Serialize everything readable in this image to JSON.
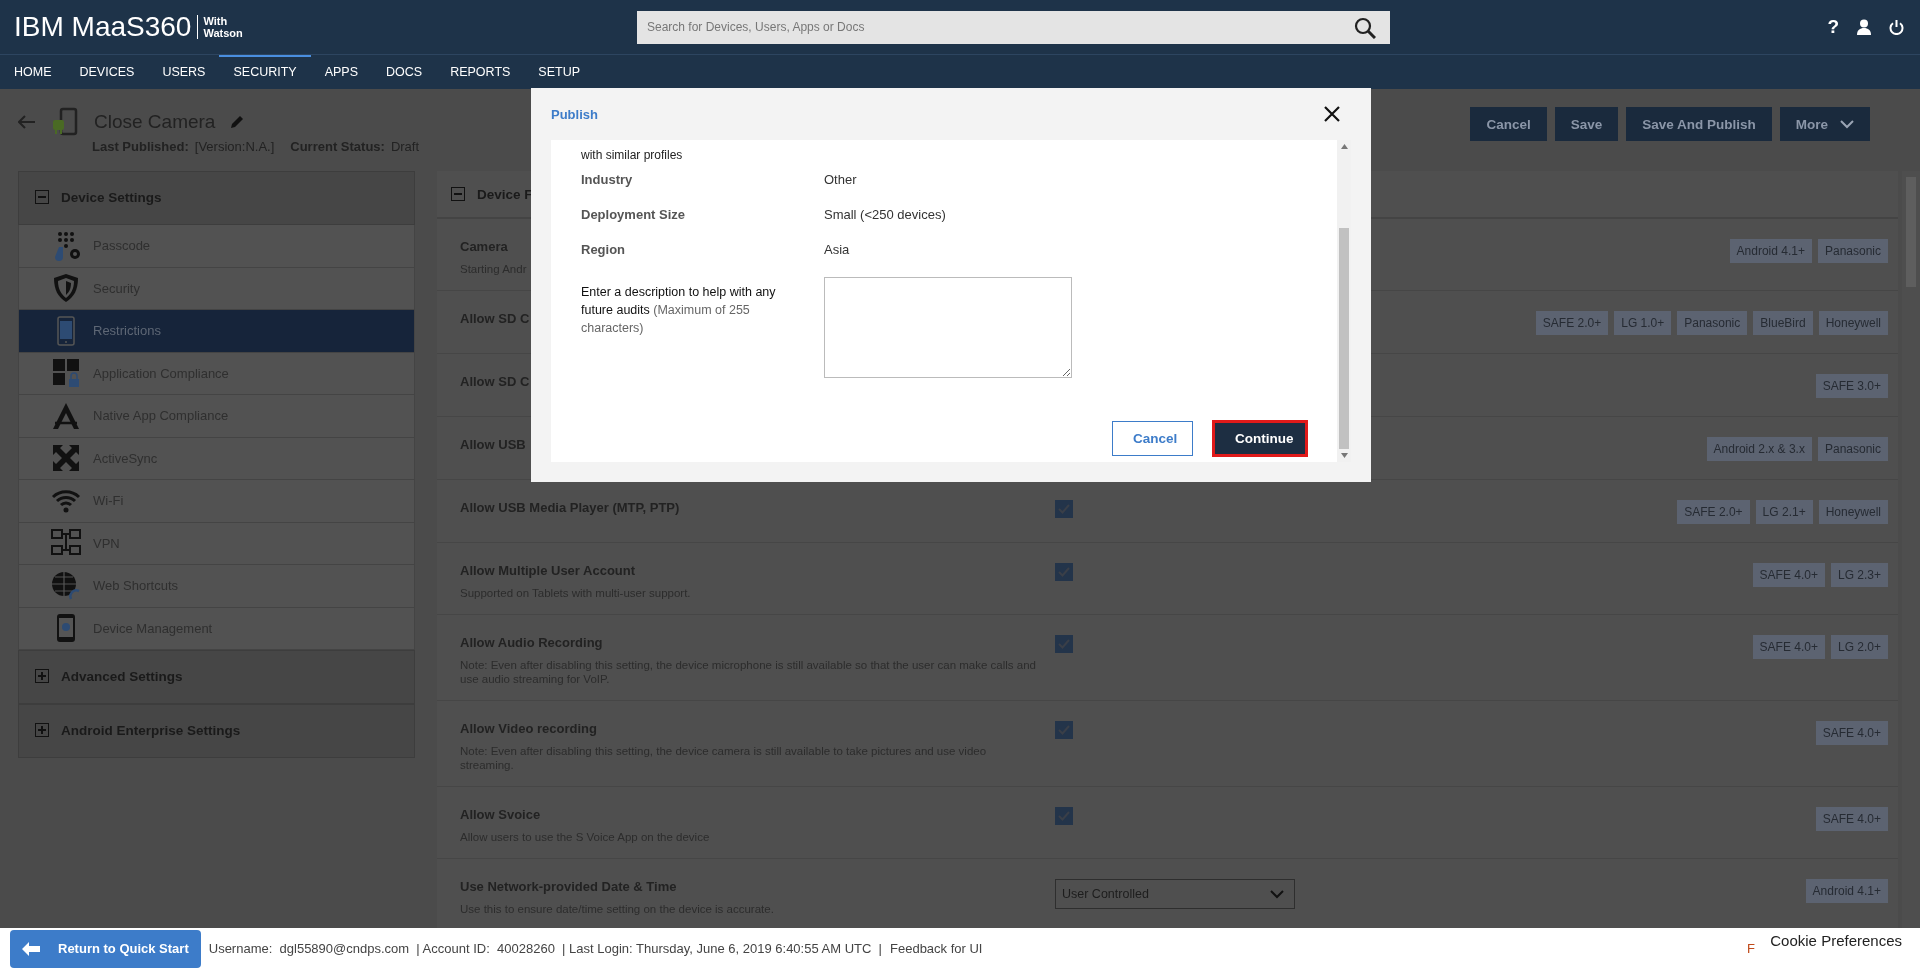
{
  "header": {
    "logo": "IBM MaaS360",
    "logo_sub": [
      "With",
      "Watson"
    ],
    "search": {
      "placeholder": "Search for Devices, Users, Apps or Docs"
    },
    "help": "?"
  },
  "nav": [
    {
      "label": "HOME",
      "selected": false
    },
    {
      "label": "DEVICES",
      "selected": false
    },
    {
      "label": "USERS",
      "selected": false
    },
    {
      "label": "SECURITY",
      "selected": true
    },
    {
      "label": "APPS",
      "selected": false
    },
    {
      "label": "DOCS",
      "selected": false
    },
    {
      "label": "REPORTS",
      "selected": false
    },
    {
      "label": "SETUP",
      "selected": false
    }
  ],
  "policy": {
    "title": "Close Camera",
    "meta": [
      {
        "label": "Last Published:",
        "value": "[Version:N.A.]"
      },
      {
        "label": "Current Status:",
        "value": "Draft"
      }
    ],
    "actions": [
      {
        "label": "Cancel",
        "kind": "plain"
      },
      {
        "label": "Save",
        "kind": "plain"
      },
      {
        "label": "Save And Publish",
        "kind": "plain"
      },
      {
        "label": "More",
        "kind": "menu"
      }
    ]
  },
  "sidebar": [
    {
      "title": "Device Settings",
      "expanded": true,
      "items": [
        {
          "label": "Passcode",
          "selected": false
        },
        {
          "label": "Security",
          "selected": false
        },
        {
          "label": "Restrictions",
          "selected": true
        },
        {
          "label": "Application Compliance",
          "selected": false
        },
        {
          "label": "Native App Compliance",
          "selected": false
        },
        {
          "label": "ActiveSync",
          "selected": false
        },
        {
          "label": "Wi-Fi",
          "selected": false
        },
        {
          "label": "VPN",
          "selected": false
        },
        {
          "label": "Web Shortcuts",
          "selected": false
        },
        {
          "label": "Device Management",
          "selected": false
        }
      ]
    },
    {
      "title": "Advanced Settings",
      "expanded": false
    },
    {
      "title": "Android Enterprise Settings",
      "expanded": false
    }
  ],
  "main": {
    "section": {
      "title": "Device F",
      "expanded": true
    },
    "rows": [
      {
        "title": "Camera",
        "description": "Starting Andr",
        "kind": "none",
        "tags": [
          "Android 4.1+",
          "Panasonic"
        ]
      },
      {
        "title": "Allow SD C",
        "kind": "none",
        "tags": [
          "SAFE 2.0+",
          "LG 1.0+",
          "Panasonic",
          "BlueBird",
          "Honeywell"
        ]
      },
      {
        "title": "Allow SD C",
        "kind": "none",
        "tags": [
          "SAFE 3.0+"
        ]
      },
      {
        "title": "Allow USB",
        "kind": "none",
        "tags": [
          "Android 2.x & 3.x",
          "Panasonic"
        ]
      },
      {
        "title": "Allow USB Media Player (MTP, PTP)",
        "kind": "checkbox",
        "checked": true,
        "tags": [
          "SAFE 2.0+",
          "LG 2.1+",
          "Honeywell"
        ]
      },
      {
        "title": "Allow Multiple User Account",
        "description": "Supported on Tablets with multi-user support.",
        "kind": "checkbox",
        "checked": true,
        "tags": [
          "SAFE 4.0+",
          "LG 2.3+"
        ]
      },
      {
        "title": "Allow Audio Recording",
        "description": "Note: Even after disabling this setting, the device microphone is still available so that the user can make calls and use audio streaming for VoIP.",
        "kind": "checkbox",
        "checked": true,
        "tags": [
          "SAFE 4.0+",
          "LG 2.0+"
        ]
      },
      {
        "title": "Allow Video recording",
        "description": "Note: Even after disabling this setting, the device camera is still available to take pictures and use video streaming.",
        "kind": "checkbox",
        "checked": true,
        "tags": [
          "SAFE 4.0+"
        ]
      },
      {
        "title": "Allow Svoice",
        "description": "Allow users to use the S Voice App on the device",
        "kind": "checkbox",
        "checked": true,
        "tags": [
          "SAFE 4.0+"
        ]
      },
      {
        "title": "Use Network-provided Date & Time",
        "description": "Use this to ensure date/time setting on the device is accurate.",
        "kind": "select",
        "value": "User Controlled",
        "tags": [
          "Android 4.1+"
        ]
      }
    ]
  },
  "modal": {
    "title": "Publish",
    "intro": "with similar profiles",
    "fields": [
      {
        "label": "Industry",
        "value": "Other"
      },
      {
        "label": "Deployment Size",
        "value": "Small (<250 devices)"
      },
      {
        "label": "Region",
        "value": "Asia"
      }
    ],
    "description": {
      "label": "Enter a description to help with any future audits",
      "hint": "(Maximum of 255 characters)"
    },
    "buttons": [
      {
        "label": "Cancel",
        "kind": "secondary"
      },
      {
        "label": "Continue",
        "kind": "primary"
      }
    ]
  },
  "footer": {
    "button": "Return to Quick Start",
    "info": "Username:  dgl55890@cndps.com  | Account ID:  40028260  | Last Login: Thursday, June 6, 2019 6:40:55 AM UTC  |",
    "link": "Feedback for UI",
    "edge": "F",
    "cookie": "Cookie Preferences"
  }
}
